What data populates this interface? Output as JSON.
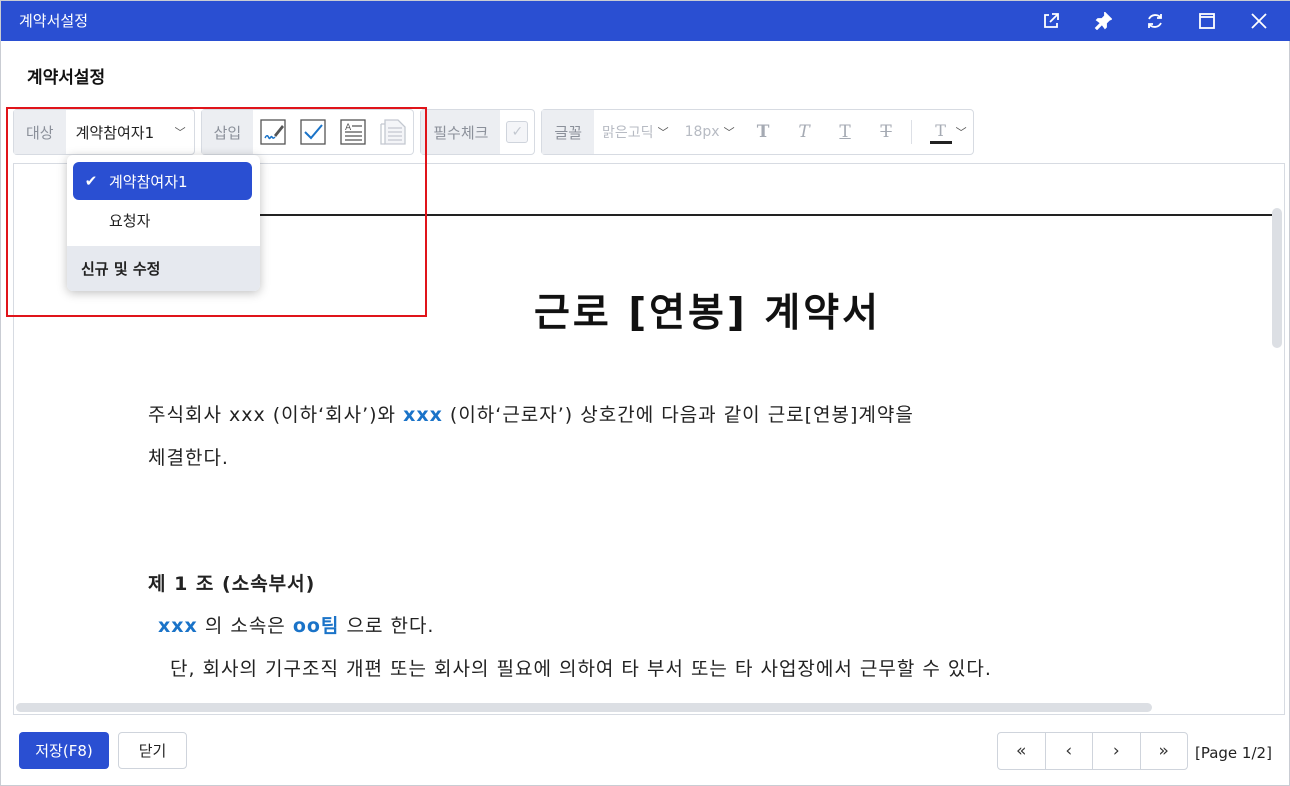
{
  "window": {
    "title": "계약서설정",
    "controls": [
      "external-link-icon",
      "pin-icon",
      "refresh-icon",
      "maximize-icon",
      "close-icon"
    ]
  },
  "heading": "계약서설정",
  "toolbar": {
    "target_label": "대상",
    "target_value": "계약참여자1",
    "insert_label": "삽입",
    "insert_icons": [
      "signature-icon",
      "checkbox-icon",
      "text-field-icon",
      "text-area-icon"
    ],
    "required_label": "필수체크",
    "font_label": "글꼴",
    "font_family": "맑은고딕",
    "font_size": "18px",
    "format_buttons": [
      "bold-icon",
      "italic-icon",
      "underline-icon",
      "strikethrough-icon"
    ],
    "text_color_glyph": "T"
  },
  "dropdown": {
    "options": [
      {
        "label": "계약참여자1",
        "selected": true
      },
      {
        "label": "요청자",
        "selected": false
      }
    ],
    "footer": "신규 및 수정"
  },
  "document": {
    "title": "근로 [연봉] 계약서",
    "intro": {
      "part1": "주식회사 xxx (이하‘회사’)와 ",
      "field1": "xxx",
      "part2": " (이하‘근로자’) 상호간에 다음과 같이 근로[연봉]계약을",
      "line2": "체결한다."
    },
    "article1": {
      "heading": "제 1 조 (소속부서)",
      "field1": "xxx",
      "text1": " 의 소속은 ",
      "field2": "oo팀",
      "text2": " 으로 한다.",
      "line2": "단, 회사의 기구조직 개편 또는 회사의 필요에 의하여 타 부서 또는 타 사업장에서 근무할 수 있다."
    }
  },
  "footer": {
    "save_label": "저장(F8)",
    "close_label": "닫기",
    "pager": [
      "«",
      "‹",
      "›",
      "»"
    ],
    "page_info": "[Page 1/2]"
  },
  "colors": {
    "primary": "#2a4fd2",
    "highlight_box": "#e0141a",
    "field_text": "#1a73c8"
  }
}
